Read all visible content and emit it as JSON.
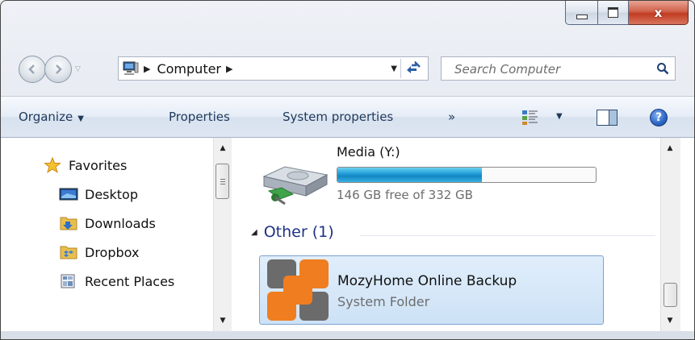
{
  "window": {
    "caption_buttons": {
      "minimize": "",
      "maximize": "",
      "close": "x"
    }
  },
  "navigation": {
    "address_breadcrumbs": [
      "Computer"
    ],
    "search_placeholder": "Search Computer"
  },
  "command_bar": {
    "organize": "Organize",
    "properties": "Properties",
    "system_properties": "System properties",
    "overflow": "»",
    "help": "?"
  },
  "sidebar": {
    "items": [
      {
        "label": "Favorites",
        "icon": "star-icon"
      },
      {
        "label": "Desktop",
        "icon": "desktop-icon"
      },
      {
        "label": "Downloads",
        "icon": "downloads-folder-icon"
      },
      {
        "label": "Dropbox",
        "icon": "dropbox-folder-icon"
      },
      {
        "label": "Recent Places",
        "icon": "recent-places-icon"
      }
    ]
  },
  "drive": {
    "name": "Media (Y:)",
    "free_text": "146 GB free of 332 GB",
    "used_fraction": 0.56,
    "icon": "hard-drive-icon"
  },
  "group": {
    "label": "Other (1)"
  },
  "folder": {
    "name": "MozyHome Online Backup",
    "type": "System Folder",
    "icon": "mozy-logo-icon"
  },
  "colors": {
    "progress": "#26a0da",
    "selection_bg": "#cde2f6",
    "group_label": "#1e3287",
    "mozy_orange": "#f07d1f",
    "mozy_gray": "#6b6b6b",
    "close_button": "#c13b22"
  }
}
